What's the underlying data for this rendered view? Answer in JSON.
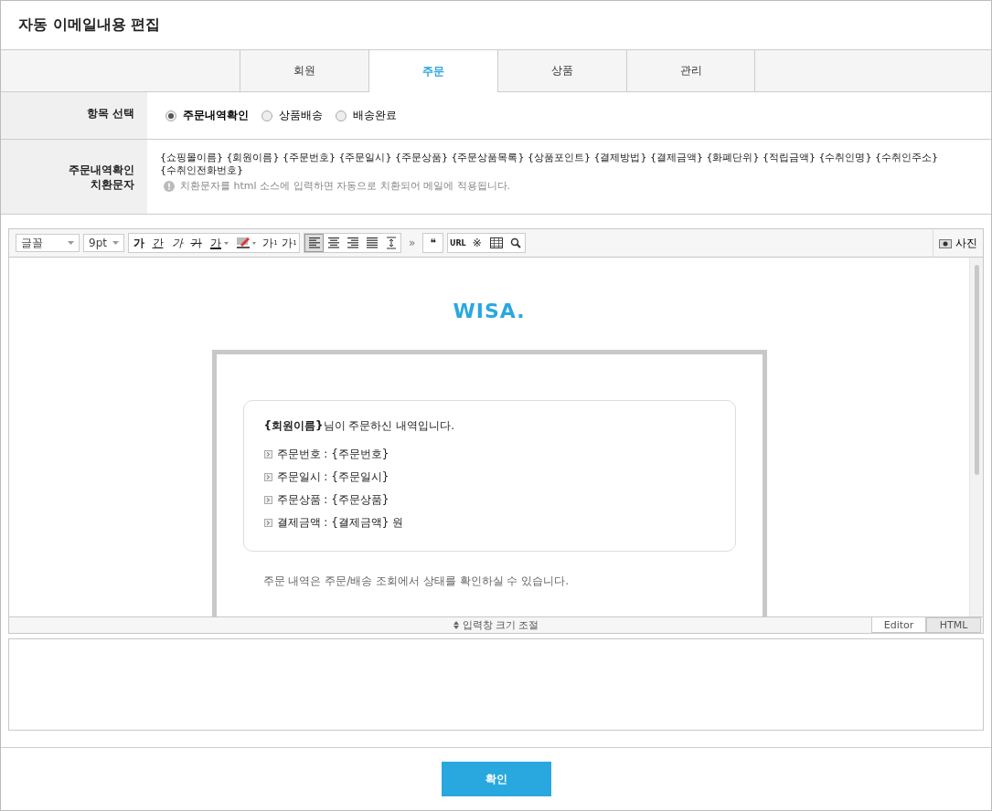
{
  "window": {
    "title": "자동 이메일내용 편집"
  },
  "tabs": [
    {
      "label": "회원",
      "selected": false
    },
    {
      "label": "주문",
      "selected": true
    },
    {
      "label": "상품",
      "selected": false
    },
    {
      "label": "관리",
      "selected": false
    }
  ],
  "form": {
    "item_label": "항목 선택",
    "options": [
      {
        "label": "주문내역확인",
        "selected": true
      },
      {
        "label": "상품배송",
        "selected": false
      },
      {
        "label": "배송완료",
        "selected": false
      }
    ],
    "codes_label": "주문내역확인\n치환문자",
    "codes": "{쇼핑몰이름} {회원이름} {주문번호} {주문일시} {주문상품} {주문상품목록} {상품포인트} {결제방법} {결제금액} {화폐단위} {적립금액} {수취인명} {수취인주소} {수취인전화번호}",
    "notice": "치환문자를 html 소스에 입력하면 자동으로 치환되어 메일에 적용됩니다."
  },
  "editor": {
    "font_select": "글꼴",
    "size_select": "9pt",
    "format_buttons": [
      {
        "kind": "bold",
        "label": "가"
      },
      {
        "kind": "underline",
        "label": "간"
      },
      {
        "kind": "italic",
        "label": "가"
      },
      {
        "kind": "strike",
        "label": "가"
      },
      {
        "kind": "color",
        "label": "가"
      },
      {
        "kind": "highlight"
      },
      {
        "kind": "sup",
        "label": "가",
        "mark": "1"
      },
      {
        "kind": "sub",
        "label": "가",
        "mark": "1"
      }
    ],
    "align_buttons": [
      {
        "kind": "left",
        "selected": true
      },
      {
        "kind": "center",
        "selected": false
      },
      {
        "kind": "right",
        "selected": false
      },
      {
        "kind": "justify",
        "selected": false
      },
      {
        "kind": "lineheight",
        "selected": false
      }
    ],
    "more": "»",
    "quote": "❝",
    "insert_buttons": [
      {
        "kind": "url",
        "label": "URL"
      },
      {
        "kind": "special",
        "label": "※"
      },
      {
        "kind": "table"
      },
      {
        "kind": "search"
      }
    ],
    "photo": "사진",
    "logo": "WISA.",
    "greeting": "**{회원이름}**님이 주문하신 내역입니다.",
    "details": [
      "주문번호 : {주문번호}",
      "주문일시 : {주문일시}",
      "주문상품 : {주문상품}",
      "결제금액 : {결제금액} 원"
    ],
    "footnote": "주문 내역은 주문/배송 조회에서 상태를 확인하실 수 있습니다.",
    "resize": "입력창 크기 조절",
    "modes": [
      {
        "label": "Editor",
        "selected": true
      },
      {
        "label": "HTML",
        "selected": false
      }
    ]
  },
  "confirm": "확인"
}
